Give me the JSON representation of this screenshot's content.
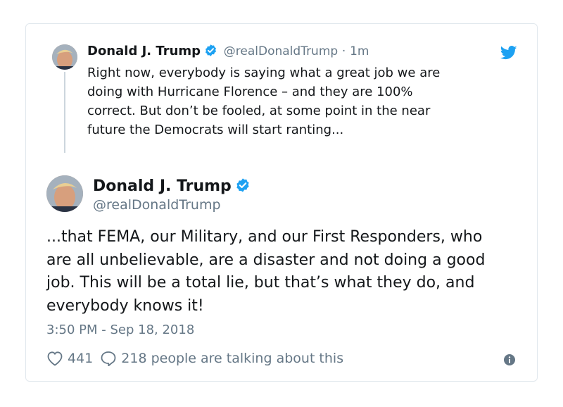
{
  "colors": {
    "verified": "#1da1f2",
    "twitter_blue": "#1da1f2",
    "secondary_text": "#657786",
    "border": "#e1e8ed"
  },
  "parent_tweet": {
    "name": "Donald J. Trump",
    "handle": "@realDonaldTrump",
    "separator": "·",
    "time": "1m",
    "text": "Right now, everybody is saying what a great job we are\ndoing with Hurricane Florence – and they are 100%\ncorrect. But don’t be fooled, at some point in the near\nfuture the Democrats will start ranting..."
  },
  "main_tweet": {
    "name": "Donald J. Trump",
    "handle": "@realDonaldTrump",
    "text": "...that FEMA, our Military, and our First Responders, who\nare all unbelievable, are a disaster and not doing a good\njob. This will be a total lie, but that’s what they do, and\neverybody knows it!",
    "timestamp": "3:50 PM - Sep 18, 2018"
  },
  "actions": {
    "like_count": "441",
    "talking_text": "218 people are talking about this"
  },
  "icons": [
    "twitter-bird-icon",
    "verified-badge-icon",
    "heart-icon",
    "reply-bubble-icon",
    "info-icon"
  ]
}
